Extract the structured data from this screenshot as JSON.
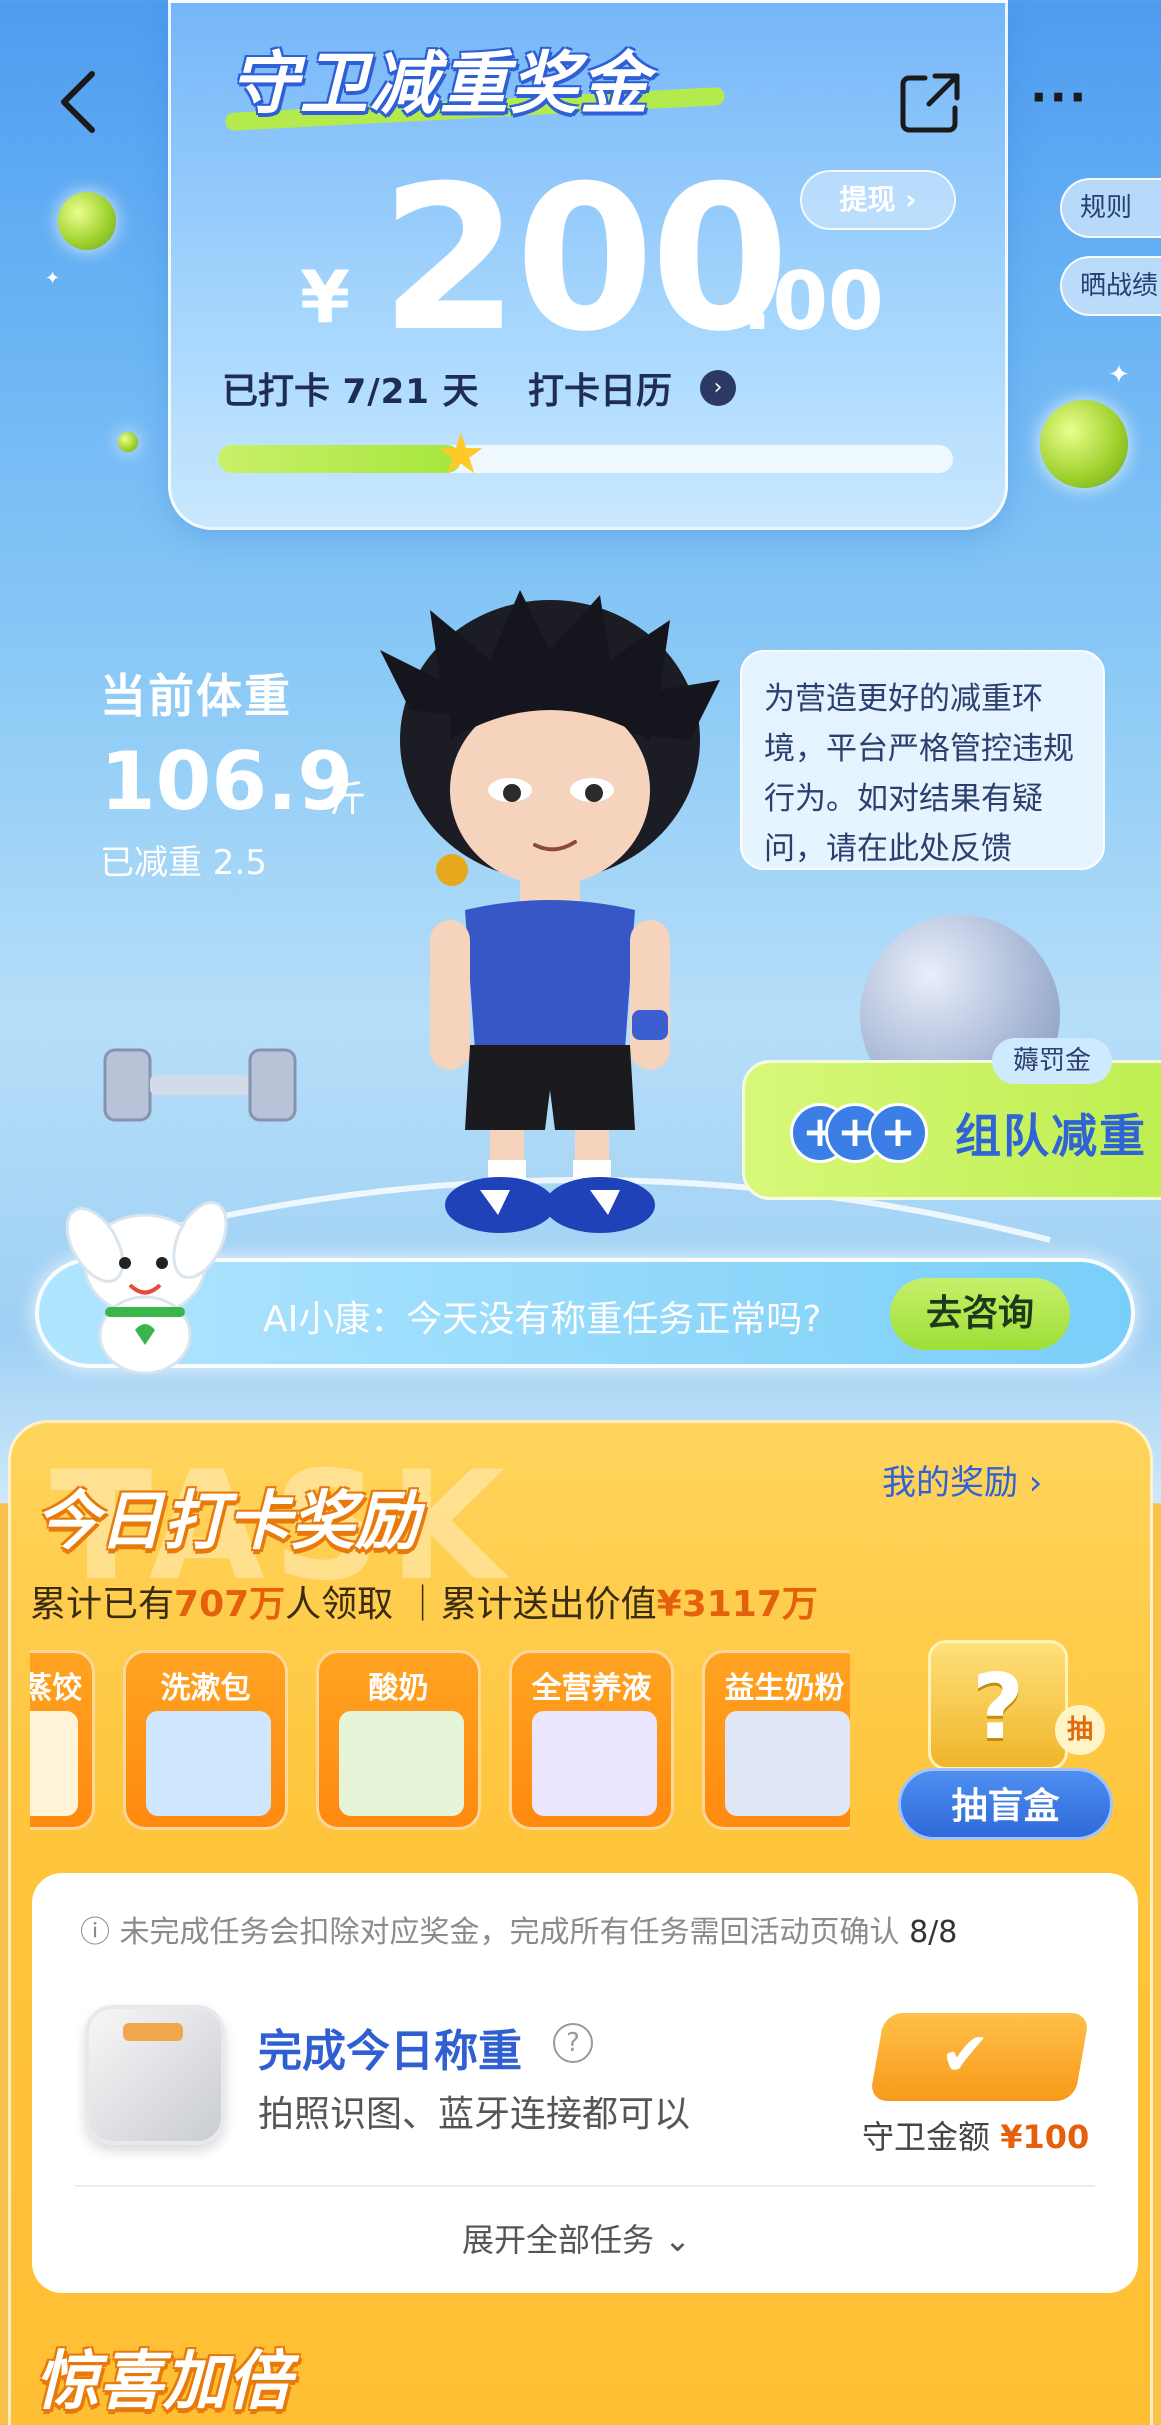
{
  "header": {
    "title": "守卫减重奖金",
    "more_label": "···"
  },
  "bonus": {
    "currency": "¥",
    "amount_int": "200",
    "amount_dec": ".00",
    "withdraw_label": "提现 ›"
  },
  "checkin": {
    "prefix": "已打卡",
    "count": "7/21",
    "suffix": "天",
    "calendar_label": "打卡日历",
    "progress": 0.33
  },
  "side_tabs": [
    "规则",
    "晒战绩"
  ],
  "weight": {
    "label": "当前体重",
    "value": "106.9",
    "unit": "斤",
    "lost": "已减重 2.5"
  },
  "bubble": {
    "text": "为营造更好的减重环境，平台严格管控违规行为。如对结果有疑问，请在此处反馈"
  },
  "team": {
    "tag": "薅罚金",
    "label": "组队减重",
    "plus": "+"
  },
  "ai": {
    "text": "AI小康：今天没有称重任务正常吗?",
    "consult_label": "去咨询"
  },
  "tasks": {
    "watermark": "TASK",
    "title": "今日打卡奖励",
    "my_reward": "我的奖励 ›",
    "stats": {
      "prefix": "累计已有",
      "people": "707万",
      "middle": "人领取 ｜累计送出价值",
      "value": "¥3117万"
    },
    "prizes": [
      "蒸饺",
      "洗漱包",
      "酸奶",
      "全营养液",
      "益生奶粉"
    ],
    "mystery_box": "?",
    "draw_tag": "抽",
    "draw_label": "抽盲盒",
    "note": "未完成任务会扣除对应奖金，完成所有任务需回活动页确认",
    "note_count": "8/8",
    "task_name": "完成今日称重",
    "task_desc": "拍照识图、蓝牙连接都可以",
    "guard_label": "守卫金额",
    "guard_value": "¥100",
    "expand_label": "展开全部任务 ⌄"
  },
  "bonus_section": {
    "title": "惊喜加倍"
  },
  "colors": {
    "accent_blue": "#2f63d6",
    "accent_orange": "#e4600c",
    "lime": "#b8f03a",
    "panel_yellow": "#ffc53c"
  }
}
